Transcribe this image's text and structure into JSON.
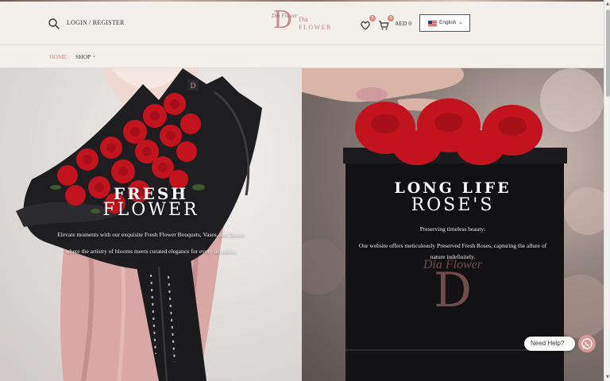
{
  "header": {
    "login_label": "LOGIN / REGISTER",
    "logo": {
      "script_text": "Dia Flower",
      "letter": "D",
      "line1": "Dia",
      "line2": "FLOWER"
    },
    "wishlist_count": "0",
    "cart_count": "0",
    "cart_total": "AED 0",
    "language": "English"
  },
  "nav": {
    "items": [
      {
        "label": "HOME",
        "active": true
      },
      {
        "label": "SHOP",
        "has_dropdown": true
      }
    ]
  },
  "hero": {
    "left": {
      "title_line1": "FRESH",
      "title_line2": "FLOWER",
      "description_line1": "Elevate moments with our exquisite Fresh Flower Bouquets, Vases, and Boxes",
      "description_line2": "where the artistry of blooms meets curated elegance for every occasion."
    },
    "right": {
      "title_line1": "LONG LIFE",
      "title_line2": "ROSE'S",
      "subtitle": "Preserving timeless beauty:",
      "description_line1": "Our website offers meticulously Preserved Fresh Roses, capturing the allure of",
      "description_line2": "nature indefinitely.",
      "box_script": "Dia Flower",
      "box_letter": "D"
    }
  },
  "help_widget": {
    "label": "Need Help?"
  },
  "colors": {
    "accent": "#d58a7f",
    "brand_pink": "#c98b8b",
    "header_bg": "#f3efea",
    "rose_red": "#c3131f"
  }
}
